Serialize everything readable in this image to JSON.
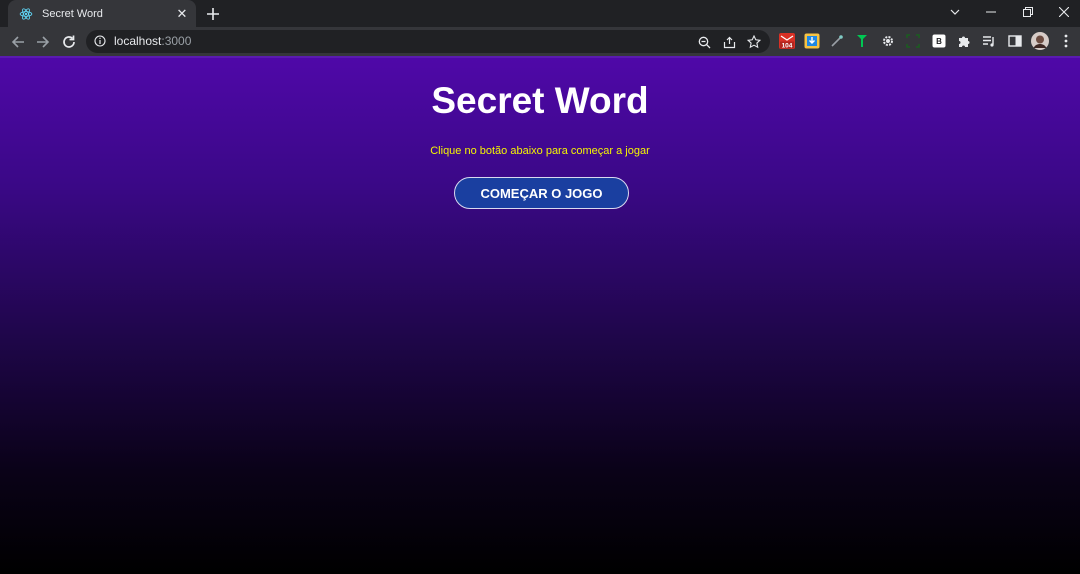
{
  "browser": {
    "tab": {
      "title": "Secret Word",
      "close_glyph": "✕"
    },
    "url": {
      "host": "localhost",
      "port": ":3000"
    },
    "extensions": {
      "mail_badge": "104",
      "b_label": "B"
    },
    "colors": {
      "frame": "#202124",
      "toolbar": "#35363a",
      "text": "#e8eaed"
    }
  },
  "page": {
    "title": "Secret Word",
    "subtitle": "Clique no botão abaixo para começar a jogar",
    "start_button": "COMEÇAR O JOGO",
    "colors": {
      "gradient_top": "#4f08a8",
      "gradient_bottom": "#000000",
      "subtitle": "#f5f500",
      "button": "#1a3fa0"
    }
  }
}
